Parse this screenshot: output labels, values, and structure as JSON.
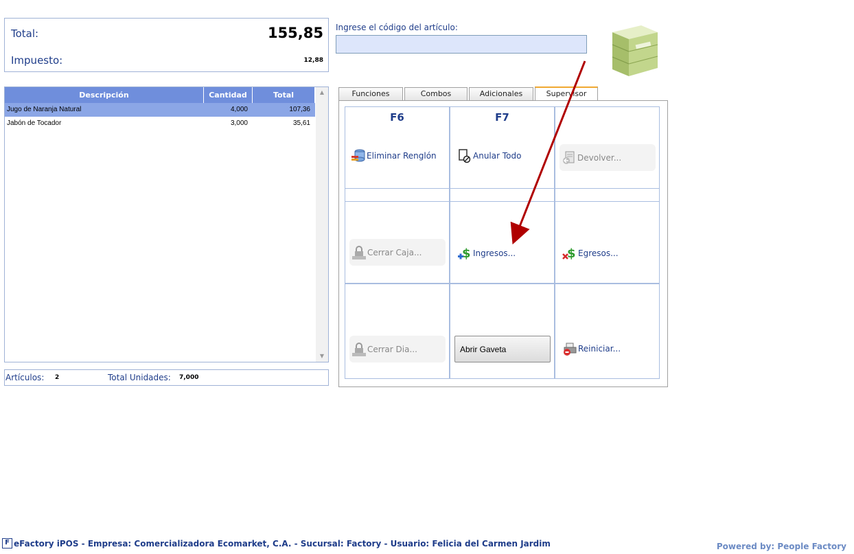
{
  "totals": {
    "total_label": "Total:",
    "total_value": "155,85",
    "tax_label": "Impuesto:",
    "tax_value": "12,88"
  },
  "grid": {
    "columns": [
      "Descripción",
      "Cantidad",
      "Total"
    ],
    "rows": [
      {
        "desc": "Jugo de Naranja Natural",
        "qty": "4,000",
        "total": "107,36",
        "selected": true
      },
      {
        "desc": "Jabón de Tocador",
        "qty": "3,000",
        "total": "35,61",
        "selected": false
      }
    ]
  },
  "counts": {
    "articles_label": "Artículos:",
    "articles_value": "2",
    "units_label": "Total Unidades:",
    "units_value": "7,000"
  },
  "code": {
    "label": "Ingrese el código del artículo:",
    "value": ""
  },
  "tabs": [
    "Funciones",
    "Combos",
    "Adicionales",
    "Supervisor"
  ],
  "active_tab": "Supervisor",
  "functions": {
    "f6": "F6",
    "f7": "F7",
    "eliminar": "Eliminar Renglón",
    "anular": "Anular Todo",
    "devolver": "Devolver...",
    "cerrar_caja": "Cerrar Caja...",
    "ingresos": "Ingresos...",
    "egresos": "Egresos...",
    "cerrar_dia": "Cerrar Dia...",
    "abrir_gaveta": "Abrir Gaveta",
    "reiniciar": "Reiniciar..."
  },
  "icons": {
    "eliminar": "database-delete-icon",
    "anular": "document-cancel-icon",
    "devolver": "return-document-icon",
    "cerrar_caja": "cash-register-lock-icon",
    "ingresos": "dollar-add-icon",
    "egresos": "dollar-remove-icon",
    "cerrar_dia": "lock-day-icon",
    "reiniciar": "printer-reset-icon",
    "logo": "efactory-logo-icon"
  },
  "status": {
    "logo_letter": "F",
    "text": "eFactory iPOS - Empresa: Comercializadora Ecomarket, C.A. - Sucursal: Factory - Usuario: Felicia del Carmen Jardim"
  },
  "powered": "Powered by: People Factory",
  "colors": {
    "header": "#6f8edc",
    "selected_row": "#8ba6e6",
    "text": "#1f3d8a",
    "active_tab_accent": "#f0a830",
    "annotation_arrow": "#b00000"
  }
}
